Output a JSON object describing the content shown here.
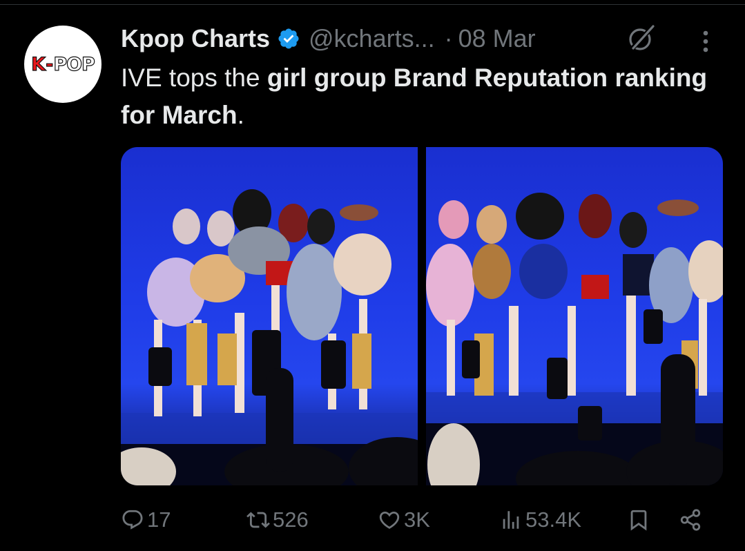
{
  "author": {
    "display_name": "Kpop Charts",
    "handle": "@kcharts...",
    "separator": "·",
    "date": "08 Mar",
    "avatar_logo": {
      "k": "K",
      "dash": "-",
      "pop": "POP"
    },
    "verified_icon": "verified-badge-icon"
  },
  "tweet": {
    "text_plain_1": "IVE tops the ",
    "text_bold": "girl group Brand Reputation ranking for March",
    "text_plain_2": "."
  },
  "media": {
    "photo_count": 2
  },
  "actions": {
    "replies": "17",
    "reposts": "526",
    "likes": "3K",
    "views": "53.4K"
  },
  "colors": {
    "background": "#000000",
    "text": "#e7e9ea",
    "muted": "#71767b",
    "verified": "#1d9bf0",
    "stage_blue": "#1f3ce8"
  },
  "icons": [
    "grok-icon",
    "more-icon",
    "reply-icon",
    "repost-icon",
    "like-icon",
    "views-icon",
    "bookmark-icon",
    "share-icon"
  ]
}
